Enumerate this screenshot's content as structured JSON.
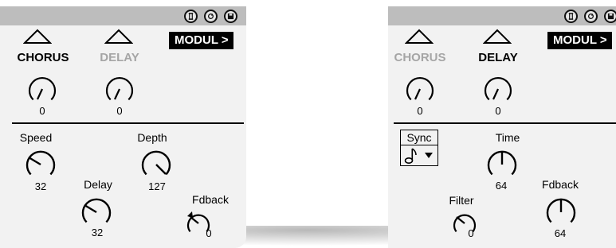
{
  "panels": [
    {
      "modul_label": "MODUL >",
      "effects": [
        {
          "name": "CHORUS",
          "state": "active",
          "value": "0"
        },
        {
          "name": "DELAY",
          "state": "inactive",
          "value": "0"
        }
      ],
      "params": [
        {
          "label": "Speed",
          "value": "32"
        },
        {
          "label": "Depth",
          "value": "127"
        },
        {
          "label": "Delay",
          "value": "32"
        },
        {
          "label": "Fdback",
          "value": "0"
        }
      ]
    },
    {
      "modul_label": "MODUL >",
      "effects": [
        {
          "name": "CHORUS",
          "state": "inactive",
          "value": "0"
        },
        {
          "name": "DELAY",
          "state": "active",
          "value": "0"
        }
      ],
      "sync": {
        "label": "Sync",
        "note_icon": "eighth-note-icon",
        "dropdown_icon": "triangle-down-icon"
      },
      "params": [
        {
          "label": "Time",
          "value": "64"
        },
        {
          "label": "Fdback",
          "value": "64"
        },
        {
          "label": "Filter",
          "value": "0"
        }
      ]
    }
  ],
  "titlebar_icons": [
    "fold-icon",
    "refresh-icon",
    "save-icon"
  ],
  "colors": {
    "panel_bg": "#f2f2f2",
    "titlebar": "#bdbdbd",
    "inactive_text": "#a5a5a5",
    "accent": "#000000"
  }
}
